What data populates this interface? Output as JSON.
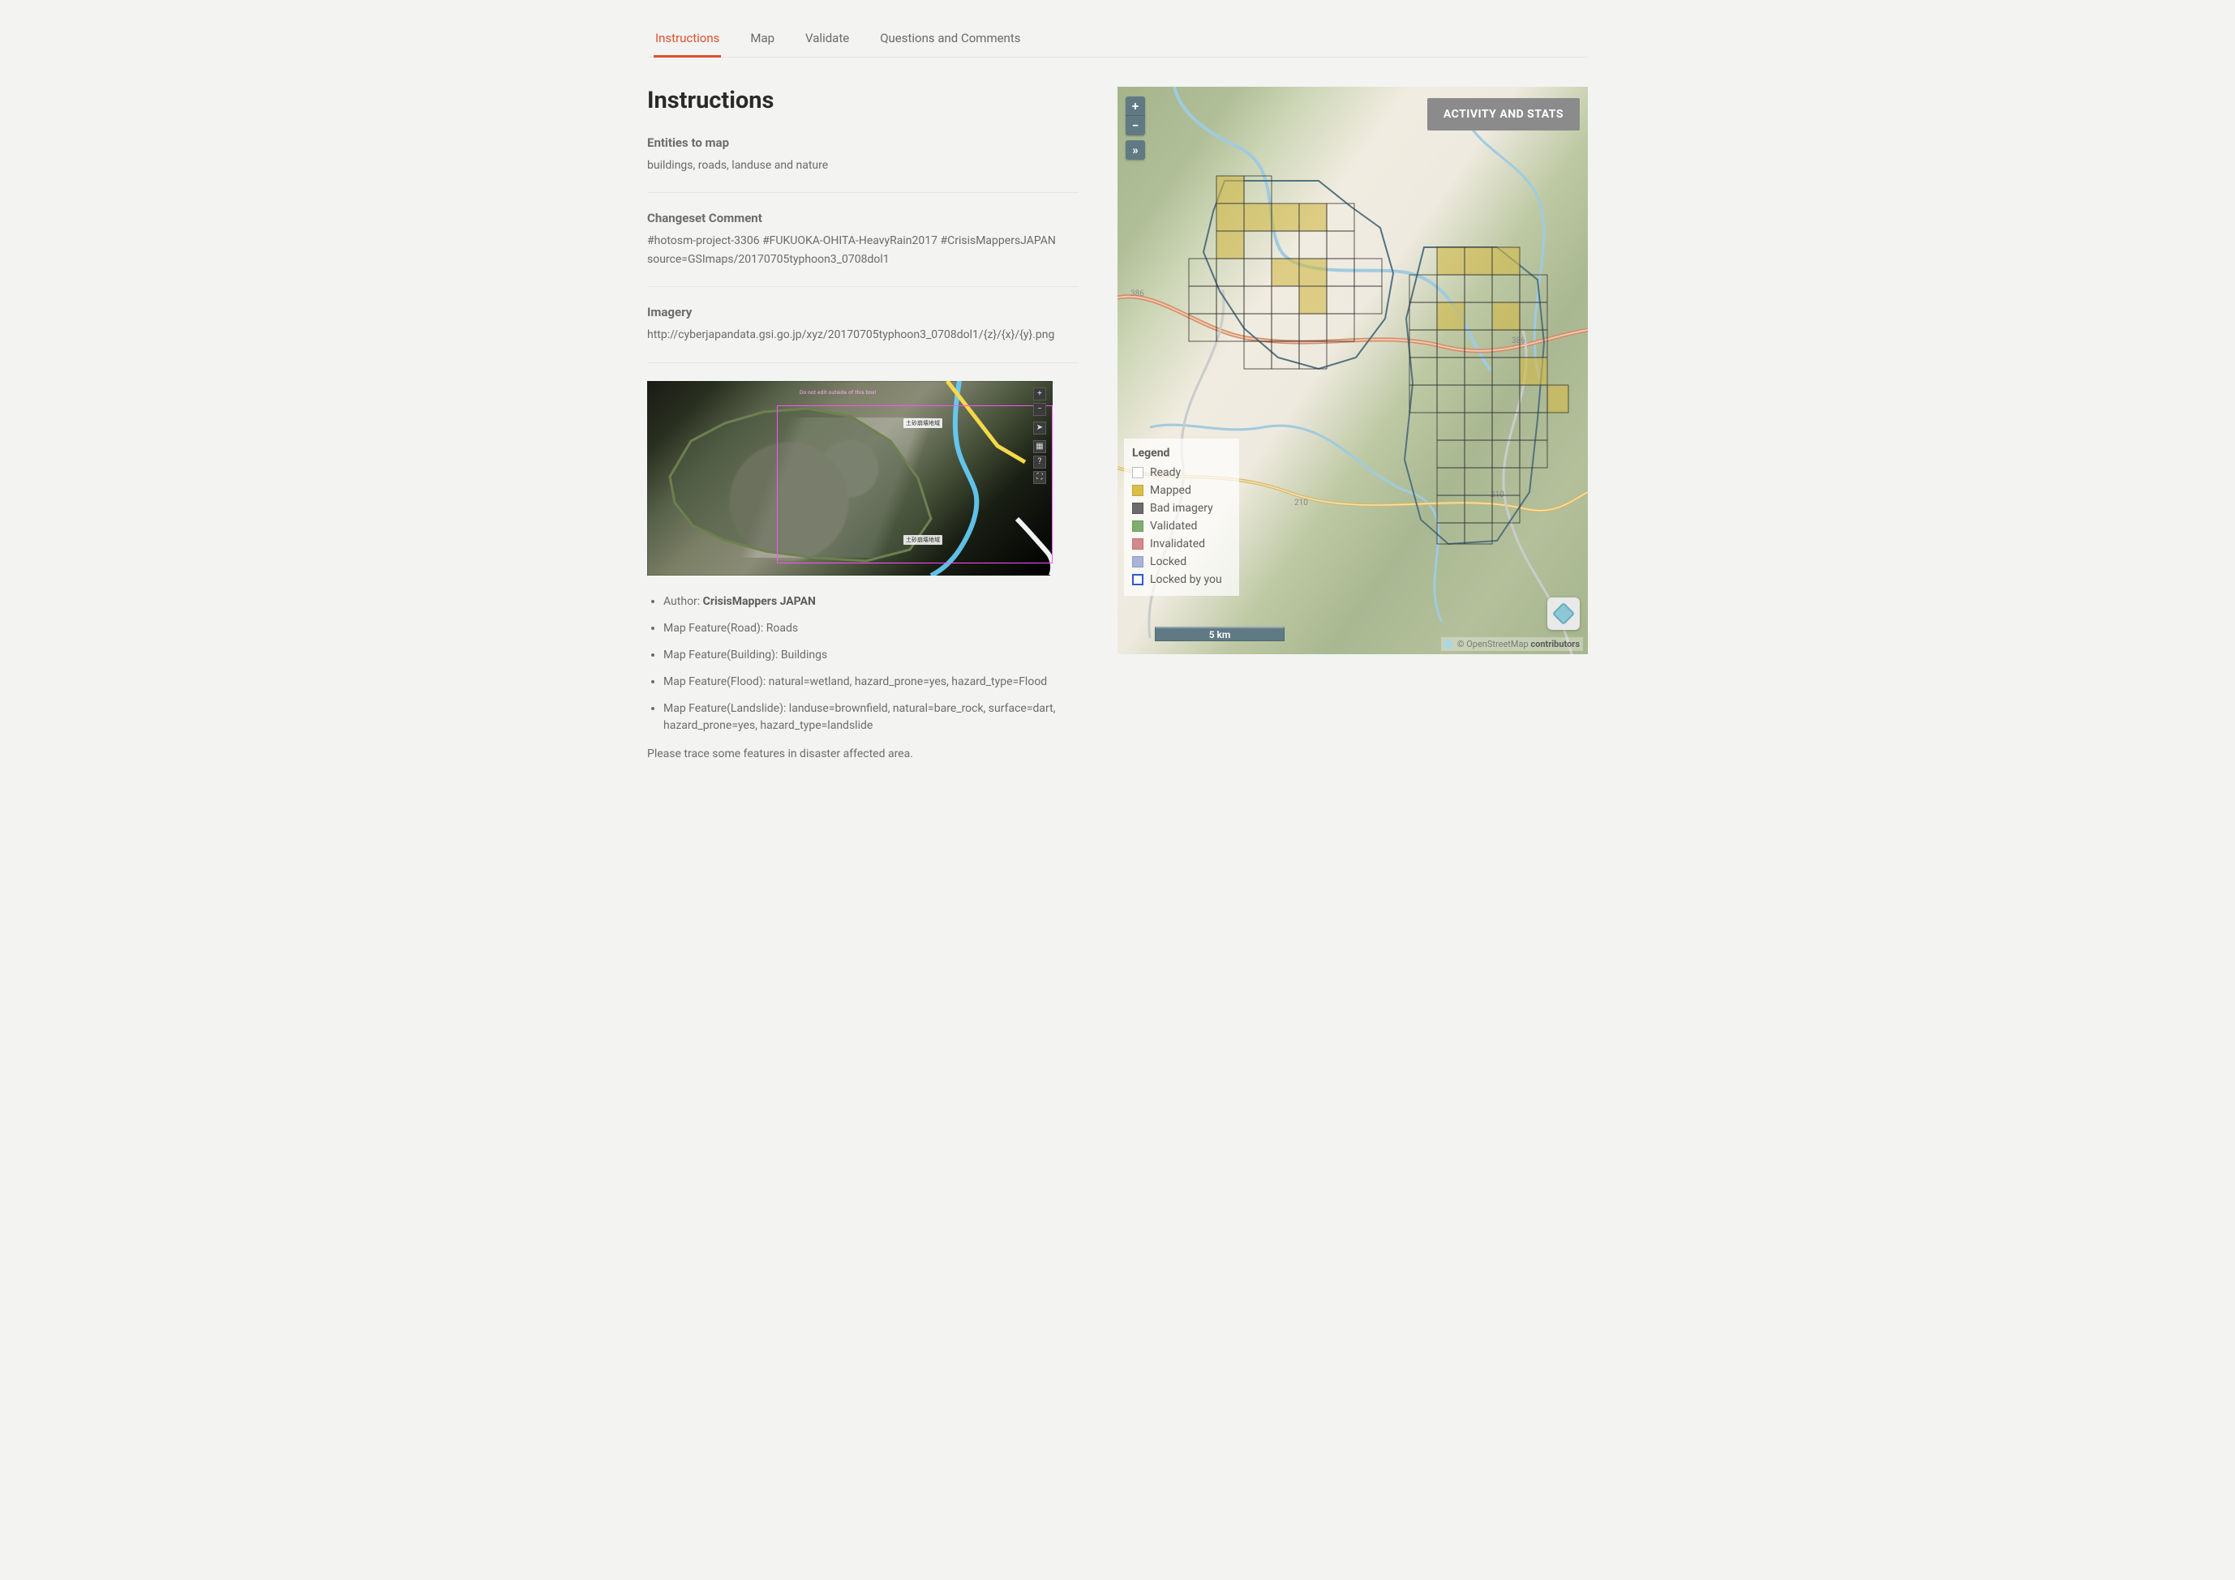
{
  "tabs": {
    "instructions": "Instructions",
    "map": "Map",
    "validate": "Validate",
    "questions": "Questions and Comments"
  },
  "left": {
    "title": "Instructions",
    "entities_title": "Entities to map",
    "entities_body": "buildings, roads, landuse and nature",
    "changeset_title": "Changeset Comment",
    "changeset_line1": "#hotosm-project-3306 #FUKUOKA-OHITA-HeavyRain2017 #CrisisMappersJAPAN",
    "changeset_line2": "source=GSImaps/20170705typhoon3_0708dol1",
    "imagery_title": "Imagery",
    "imagery_body": "http://cyberjapandata.gsi.go.jp/xyz/20170705typhoon3_0708dol1/{z}/{x}/{y}.png",
    "preview_banner": "Do not edit outside of this box!",
    "preview_label_a": "土砂崩壊地域",
    "preview_label_b": "土砂崩壊地域",
    "bullets": {
      "author_label": "Author: ",
      "author_value": "CrisisMappers JAPAN",
      "road": "Map Feature(Road): Roads",
      "building": "Map Feature(Building): Buildings",
      "flood": "Map Feature(Flood): natural=wetland, hazard_prone=yes, hazard_type=Flood",
      "landslide": "Map Feature(Landslide): landuse=brownfield, natural=bare_rock, surface=dart, hazard_prone=yes, hazard_type=landslide"
    },
    "note": "Please trace some features in disaster affected area."
  },
  "map": {
    "activity_btn": "ACTIVITY AND STATS",
    "scalebar": "5 km",
    "attribution_prefix": "© OpenStreetMap ",
    "attribution_strong": "contributors",
    "legend": {
      "title": "Legend",
      "ready": "Ready",
      "mapped": "Mapped",
      "bad": "Bad imagery",
      "validated": "Validated",
      "invalidated": "Invalidated",
      "locked": "Locked",
      "lockedyou": "Locked by you"
    },
    "road_labels": {
      "r386a": "386",
      "r386b": "386",
      "r210a": "210",
      "r210b": "210"
    },
    "zoom_plus": "+",
    "zoom_minus": "−",
    "expand": "»"
  },
  "preview_tools": {
    "plus": "+",
    "minus": "−",
    "locate": "➤",
    "layers": "▦",
    "help": "?",
    "full": "⛶"
  }
}
